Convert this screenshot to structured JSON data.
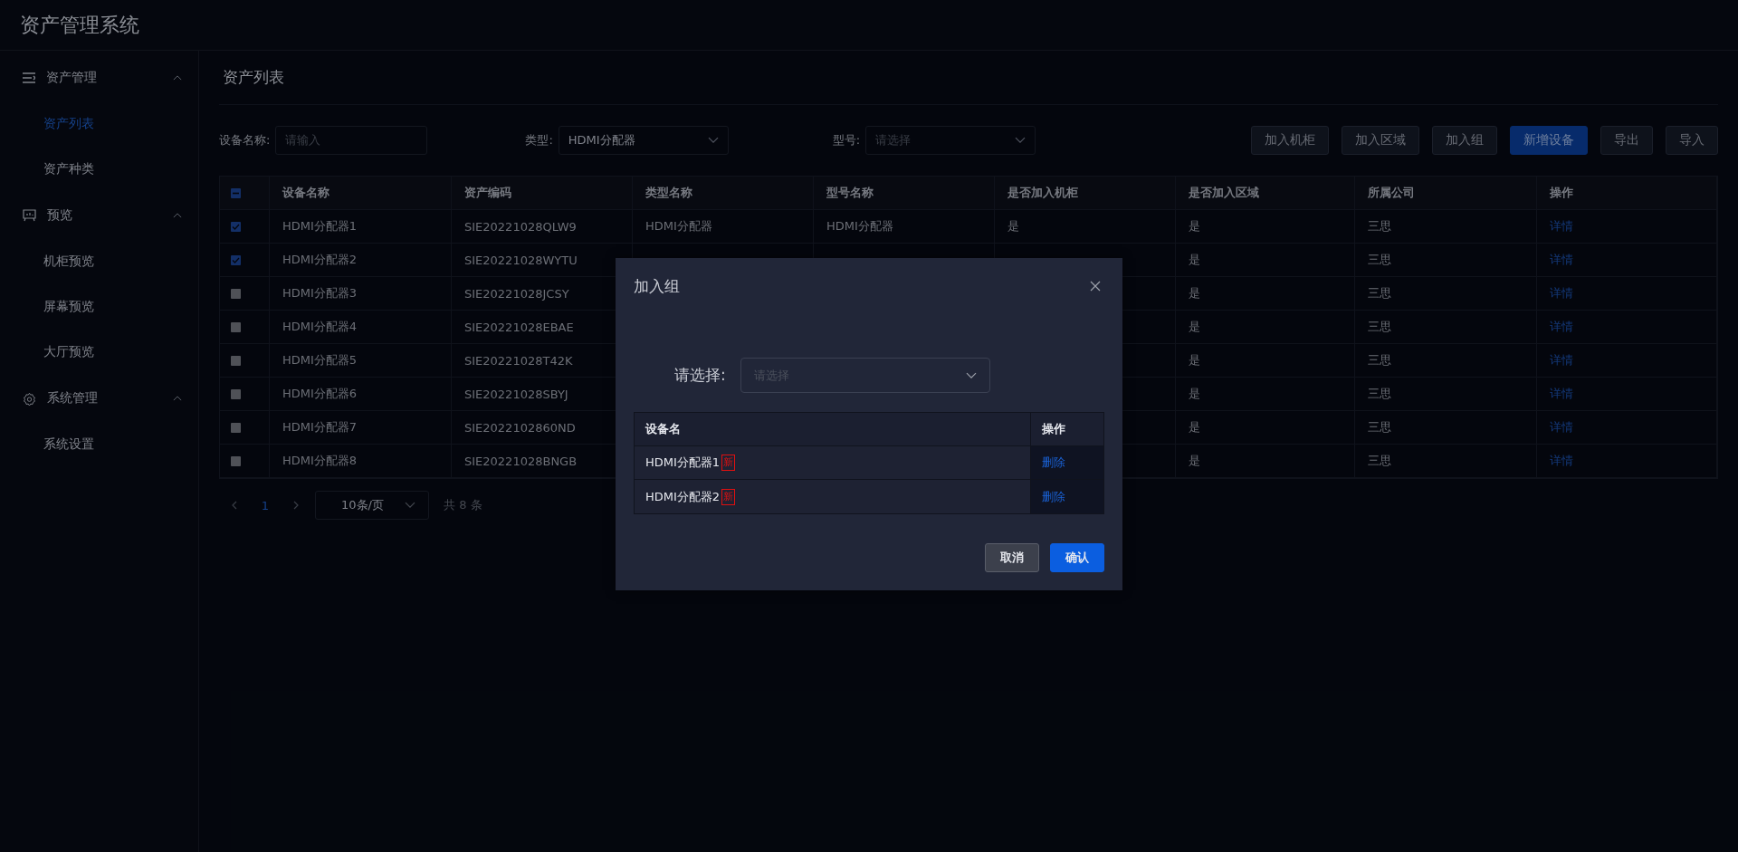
{
  "app_title": "资产管理系统",
  "sidebar": {
    "groups": [
      {
        "label": "资产管理",
        "expanded": true,
        "children": [
          {
            "label": "资产列表",
            "selected": true
          },
          {
            "label": "资产种类",
            "selected": false
          }
        ]
      },
      {
        "label": "预览",
        "expanded": true,
        "children": [
          {
            "label": "机柜预览",
            "selected": false
          },
          {
            "label": "屏幕预览",
            "selected": false
          },
          {
            "label": "大厅预览",
            "selected": false
          }
        ]
      },
      {
        "label": "系统管理",
        "expanded": true,
        "children": [
          {
            "label": "系统设置",
            "selected": false
          }
        ]
      }
    ]
  },
  "page_title": "资产列表",
  "filters": [
    {
      "label": "设备名称:",
      "kind": "input",
      "placeholder": "请输入"
    },
    {
      "label": "类型:",
      "kind": "select",
      "value": "HDMI分配器"
    },
    {
      "label": "型号:",
      "kind": "select",
      "placeholder": "请选择"
    }
  ],
  "toolbar": [
    {
      "label": "加入机柜",
      "kind": "default"
    },
    {
      "label": "加入区域",
      "kind": "default"
    },
    {
      "label": "加入组",
      "kind": "default"
    },
    {
      "label": "新增设备",
      "kind": "primary"
    },
    {
      "label": "导出",
      "kind": "default"
    },
    {
      "label": "导入",
      "kind": "default"
    }
  ],
  "table": {
    "select_all": {
      "checked": false,
      "indeterminate": true
    },
    "columns": [
      "设备名称",
      "资产编码",
      "类型名称",
      "型号名称",
      "是否加入机柜",
      "是否加入区域",
      "所属公司",
      "操作"
    ],
    "rows": [
      {
        "checked": true,
        "cells": [
          "HDMI分配器1",
          "SIE20221028QLW9",
          "HDMI分配器",
          "HDMI分配器",
          "是",
          "是",
          "三思",
          "详情"
        ]
      },
      {
        "checked": true,
        "cells": [
          "HDMI分配器2",
          "SIE20221028WYTU",
          null,
          null,
          null,
          "是",
          "三思",
          "详情"
        ]
      },
      {
        "checked": false,
        "cells": [
          "HDMI分配器3",
          "SIE20221028JCSY",
          null,
          null,
          null,
          "是",
          "三思",
          "详情"
        ]
      },
      {
        "checked": false,
        "cells": [
          "HDMI分配器4",
          "SIE20221028EBAE",
          null,
          null,
          null,
          "是",
          "三思",
          "详情"
        ]
      },
      {
        "checked": false,
        "cells": [
          "HDMI分配器5",
          "SIE20221028T42K",
          null,
          null,
          null,
          "是",
          "三思",
          "详情"
        ]
      },
      {
        "checked": false,
        "cells": [
          "HDMI分配器6",
          "SIE20221028SBYJ",
          null,
          null,
          null,
          "是",
          "三思",
          "详情"
        ]
      },
      {
        "checked": false,
        "cells": [
          "HDMI分配器7",
          "SIE2022102860ND",
          null,
          null,
          null,
          "是",
          "三思",
          "详情"
        ]
      },
      {
        "checked": false,
        "cells": [
          "HDMI分配器8",
          "SIE20221028BNGB",
          null,
          null,
          null,
          "是",
          "三思",
          "详情"
        ]
      }
    ]
  },
  "pagination": {
    "pages": [
      {
        "label": "1",
        "selected": true
      }
    ],
    "page_size": "10条/页",
    "total": "共 8 条"
  },
  "dialog": {
    "title": "加入组",
    "select_label": "请选择:",
    "select_placeholder": "请选择",
    "columns": [
      "设备名",
      "操作"
    ],
    "rows": [
      {
        "name": "HDMI分配器1",
        "badge": "新",
        "action": "删除"
      },
      {
        "name": "HDMI分配器2",
        "badge": "新",
        "action": "删除"
      }
    ],
    "buttons": [
      {
        "label": "取消",
        "kind": "default"
      },
      {
        "label": "确认",
        "kind": "primary"
      }
    ]
  }
}
